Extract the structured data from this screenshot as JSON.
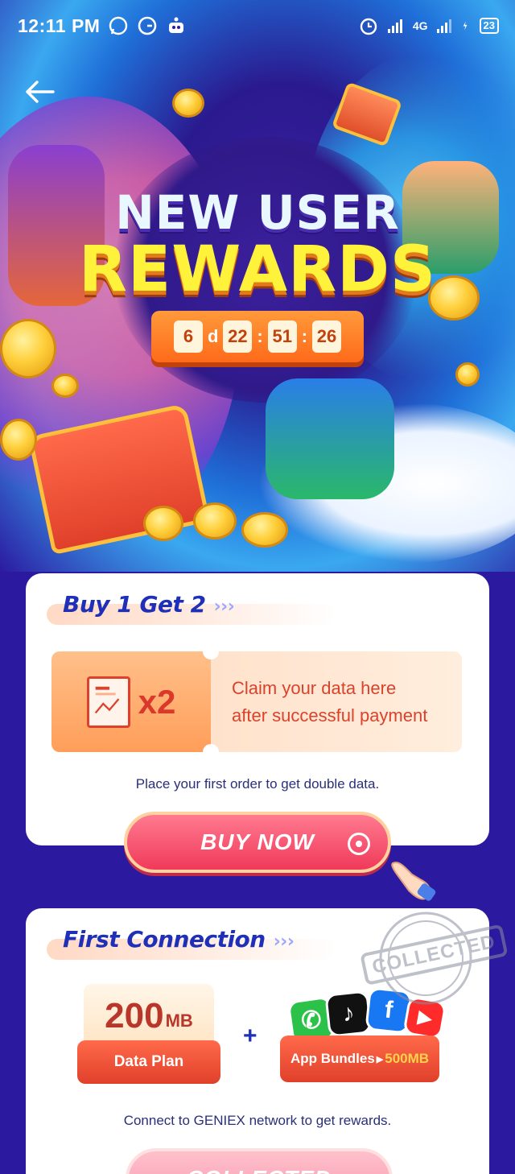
{
  "status_bar": {
    "time": "12:11 PM",
    "network": "4G",
    "battery": "23"
  },
  "hero": {
    "title_line1": "NEW USER",
    "title_line2": "REWARDS",
    "countdown": {
      "days": "6",
      "days_unit": "d",
      "hours": "22",
      "minutes": "51",
      "seconds": "26"
    }
  },
  "offer_buy": {
    "title": "Buy 1 Get 2",
    "multiplier": "x2",
    "claim_line1": "Claim your data here",
    "claim_line2": "after successful payment",
    "description": "Place your first order to get double data.",
    "button_label": "BUY NOW"
  },
  "offer_connection": {
    "title": "First Connection",
    "stamp": "COLLECTED",
    "data_amount": "200",
    "data_unit": "MB",
    "data_label": "Data Plan",
    "plus": "+",
    "bundle_label": "App Bundles",
    "bundle_extra": "500MB",
    "description": "Connect to GENIEX network to get rewards.",
    "button_label": "COLLECTED"
  },
  "colors": {
    "background": "#2b1aa0",
    "title_blue": "#1f2fb8",
    "accent_red": "#e0402a",
    "button_pink": "#f03a5a"
  }
}
